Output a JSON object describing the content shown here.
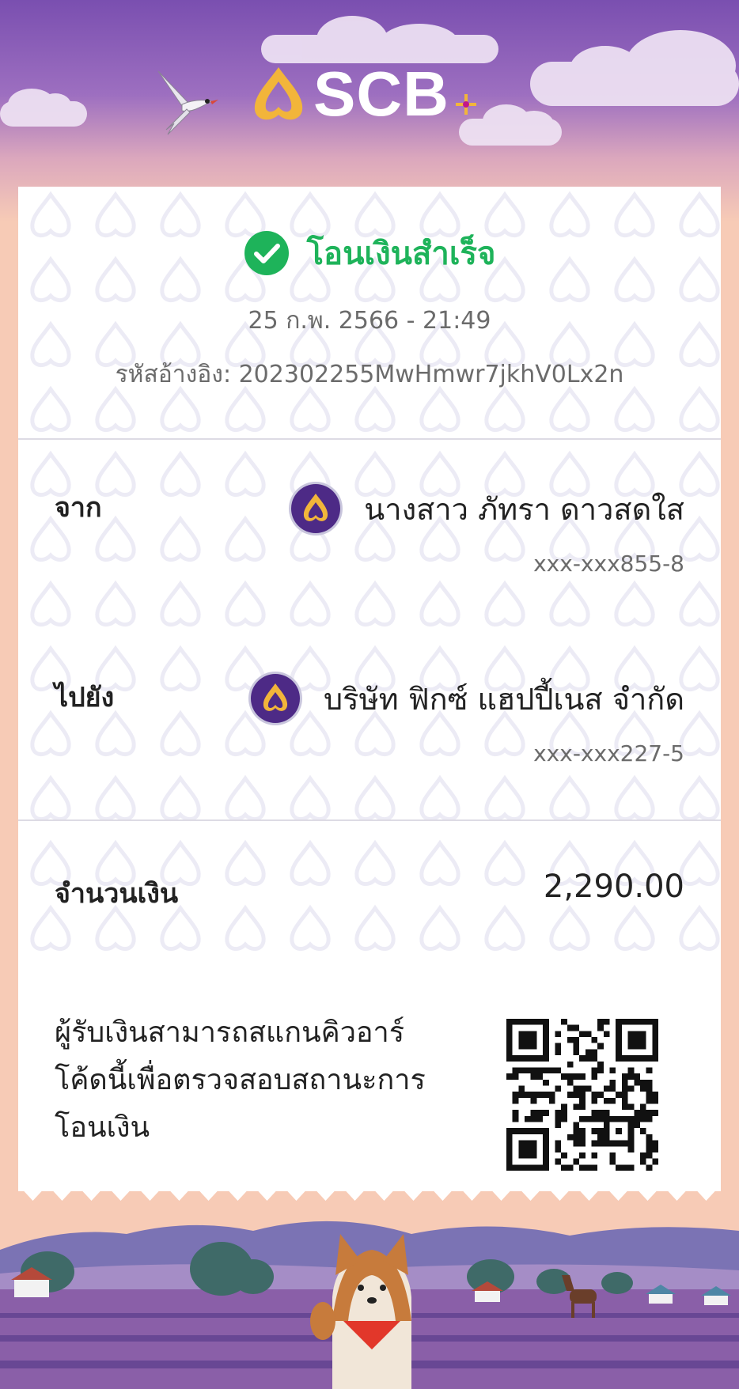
{
  "brand": {
    "name": "SCB",
    "colors": {
      "purple": "#4d2a86",
      "gold": "#f2b53a",
      "green": "#1eb35a"
    }
  },
  "status": {
    "icon": "check-circle-icon",
    "title": "โอนเงินสำเร็จ",
    "datetime": "25 ก.พ. 2566 - 21:49",
    "reference_label": "รหัสอ้างอิง:",
    "reference_value": "202302255MwHmwr7jkhV0Lx2n"
  },
  "from": {
    "label": "จาก",
    "name": "นางสาว ภัทรา ดาวสดใส",
    "account": "xxx-xxx855-8",
    "icon": "scb-bank-icon"
  },
  "to": {
    "label": "ไปยัง",
    "name": "บริษัท ฟิกซ์ แฮปปี้เนส จำกัด",
    "account": "xxx-xxx227-5",
    "icon": "scb-bank-icon"
  },
  "amount": {
    "label": "จำนวนเงิน",
    "value": "2,290.00"
  },
  "qr": {
    "note_line1": "ผู้รับเงินสามารถสแกนคิวอาร์",
    "note_line2": "โค้ดนี้เพื่อตรวจสอบสถานะการ",
    "note_line3": "โอนเงิน",
    "icon": "qr-code-icon"
  }
}
